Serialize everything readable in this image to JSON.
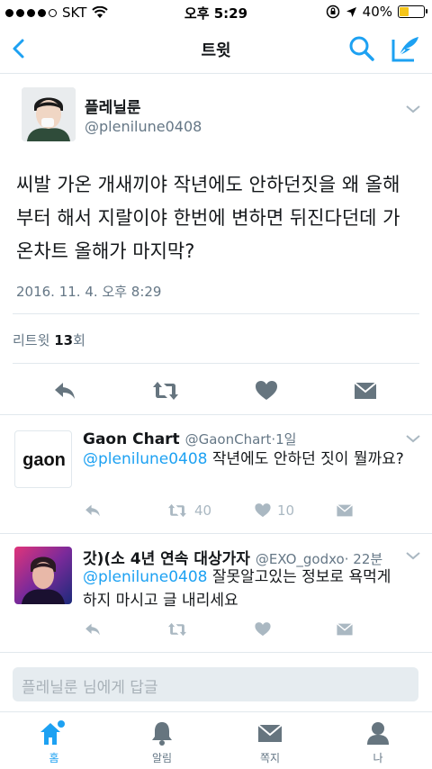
{
  "status_bar": {
    "carrier": "SKT",
    "time": "오후 5:29",
    "battery_percent": "40%",
    "battery_level": 0.4
  },
  "nav": {
    "title": "트윗"
  },
  "main_tweet": {
    "name": "플레닐룬",
    "handle": "@plenilune0408",
    "text": "씨발 가온 개새끼야 작년에도 안하던짓을 왜 올해부터 해서 지랄이야 한번에 변하면 뒤진다던데 가온차트 올해가 마지막?",
    "date": "2016. 11. 4. 오후 8:29",
    "retweets_label": "리트윗",
    "retweets_count": "13",
    "retweets_suffix": "회"
  },
  "replies": [
    {
      "name": "Gaon Chart",
      "handle": "@GaonChart",
      "time": "·1일",
      "mention": "@plenilune0408",
      "text": " 작년에도 안하던 짓이 뭘까요?",
      "retweets": "40",
      "likes": "10",
      "avatar_text": "gaon"
    },
    {
      "name": "갓)(소 4년 연속 대상가자",
      "handle": "@EXO_godxo",
      "time": "· 22분",
      "mention": "@plenilune0408",
      "text": " 잘못알고있는 정보로 욕먹게 하지 마시고 글 내리세요",
      "retweets": "",
      "likes": ""
    }
  ],
  "reply_box": {
    "placeholder": "플레닐룬 님에게 답글"
  },
  "tabs": [
    {
      "label": "홈",
      "icon": "home-icon"
    },
    {
      "label": "알림",
      "icon": "bell-icon"
    },
    {
      "label": "쪽지",
      "icon": "envelope-icon"
    },
    {
      "label": "나",
      "icon": "person-icon"
    }
  ],
  "colors": {
    "accent": "#1da1f2",
    "muted": "#657786",
    "icon_gray": "#aab8c2",
    "dark_icon": "#66757f"
  }
}
